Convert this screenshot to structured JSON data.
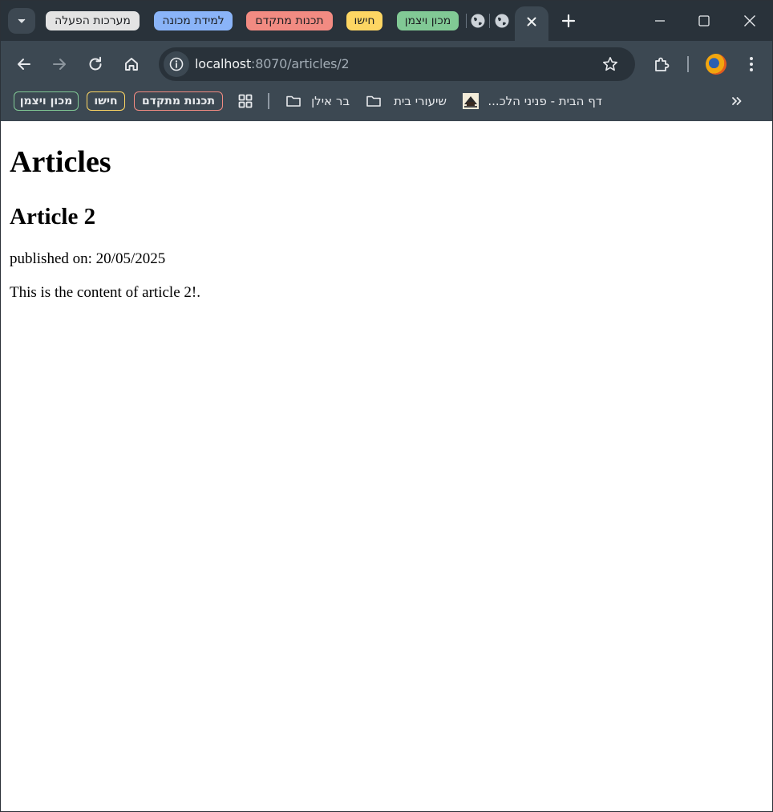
{
  "tab_groups": [
    {
      "label": "מערכות הפעלה",
      "color": "#e3e3e3"
    },
    {
      "label": "למידת מכונה",
      "color": "#8ab4f8"
    },
    {
      "label": "תכנות מתקדם",
      "color": "#f28b82"
    },
    {
      "label": "חישו",
      "color": "#fdd663"
    },
    {
      "label": "מכון ויצמן",
      "color": "#81c995"
    }
  ],
  "address_bar": {
    "host": "localhost",
    "path": ":8070/articles/2"
  },
  "bookmarks": {
    "groups": [
      {
        "label": "מכון ויצמן",
        "color": "#81c995"
      },
      {
        "label": "חישו",
        "color": "#fdd663"
      },
      {
        "label": "תכנות מתקדם",
        "color": "#f28b82"
      }
    ],
    "folders": [
      {
        "label": "בר אילן",
        "icon": "folder-icon"
      },
      {
        "label": "שיעורי בית",
        "icon": "folder-icon"
      }
    ],
    "page_link": {
      "label": "דף הבית - פניני הלכ...",
      "icon": "site-favicon-icon"
    },
    "apps_icon": "apps-grid-icon",
    "overflow_icon": "double-chevron-icon"
  },
  "page": {
    "heading": "Articles",
    "article_title": "Article 2",
    "published": "published on: 20/05/2025",
    "content": "This is the content of article 2!."
  }
}
